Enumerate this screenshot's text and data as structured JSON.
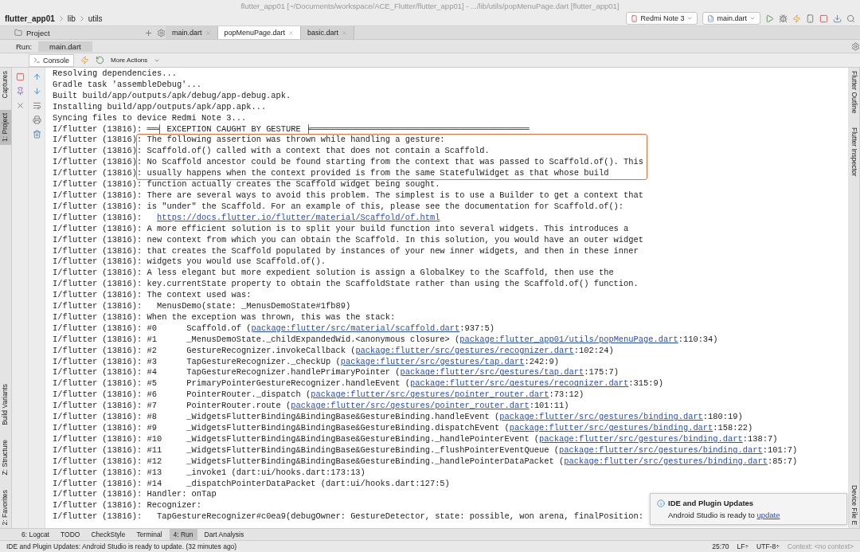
{
  "window": {
    "title": "flutter_app01 [~/Documents/workspace/ACE_Flutter/flutter_app01] - .../lib/utils/popMenuPage.dart [flutter_app01]"
  },
  "breadcrumb": [
    "flutter_app01",
    "lib",
    "utils"
  ],
  "toolbar": {
    "device": "Redmi Note 3",
    "run_config": "main.dart"
  },
  "project_dropdown": "Project",
  "editor_tabs": [
    {
      "label": "main.dart",
      "selected": false
    },
    {
      "label": "popMenuPage.dart",
      "selected": true
    },
    {
      "label": "basic.dart",
      "selected": false
    }
  ],
  "run": {
    "label": "Run:",
    "tab": "main.dart"
  },
  "console_toolbar": {
    "tab": "Console",
    "more_actions": "More Actions"
  },
  "left_strip": {
    "top": [
      {
        "label": "Captures",
        "selected": false
      },
      {
        "label": "1: Project",
        "selected": true
      }
    ],
    "bottom": [
      {
        "label": "Build Variants",
        "selected": false
      },
      {
        "label": "Z: Structure",
        "selected": false
      },
      {
        "label": "2: Favorites",
        "selected": false
      }
    ]
  },
  "right_strip": {
    "top": [
      "Flutter Outline",
      "Flutter Inspector"
    ],
    "bottom": [
      "Device File E"
    ]
  },
  "console": {
    "lines": [
      {
        "text": "Resolving dependencies...",
        "highlighted": false
      },
      {
        "text": "Gradle task 'assembleDebug'...",
        "highlighted": false
      },
      {
        "text": "Built build/app/outputs/apk/debug/app-debug.apk.",
        "highlighted": false
      },
      {
        "text": "Installing build/app/outputs/apk/app.apk...",
        "highlighted": false
      },
      {
        "text": "Syncing files to device Redmi Note 3...",
        "highlighted": false
      },
      {
        "tag": "I/flutter (13816)",
        "text": ": ══╡ EXCEPTION CAUGHT BY GESTURE ╞════════════════════════════════════════════",
        "highlighted": false
      },
      {
        "tag": "I/flutter (13816)",
        "text": ": The following assertion was thrown while handling a gesture:",
        "highlighted": true
      },
      {
        "tag": "I/flutter (13816)",
        "text": ": Scaffold.of() called with a context that does not contain a Scaffold.",
        "highlighted": true
      },
      {
        "tag": "I/flutter (13816)",
        "text": ": No Scaffold ancestor could be found starting from the context that was passed to Scaffold.of(). This",
        "highlighted": true
      },
      {
        "tag": "I/flutter (13816)",
        "text": ": usually happens when the context provided is from the same StatefulWidget as that whose build",
        "highlighted": true
      },
      {
        "tag": "I/flutter (13816)",
        "text": ": function actually creates the Scaffold widget being sought.",
        "highlighted": false
      },
      {
        "tag": "I/flutter (13816)",
        "text": ": There are several ways to avoid this problem. The simplest is to use a Builder to get a context that",
        "highlighted": false
      },
      {
        "tag": "I/flutter (13816)",
        "text": ": is \"under\" the Scaffold. For an example of this, please see the documentation for Scaffold.of():",
        "highlighted": false
      },
      {
        "tag": "I/flutter (13816)",
        "text": ":   ",
        "link": "https://docs.flutter.io/flutter/material/Scaffold/of.html",
        "highlighted": false
      },
      {
        "tag": "I/flutter (13816)",
        "text": ": A more efficient solution is to split your build function into several widgets. This introduces a",
        "highlighted": false
      },
      {
        "tag": "I/flutter (13816)",
        "text": ": new context from which you can obtain the Scaffold. In this solution, you would have an outer widget",
        "highlighted": false
      },
      {
        "tag": "I/flutter (13816)",
        "text": ": that creates the Scaffold populated by instances of your new inner widgets, and then in these inner",
        "highlighted": false
      },
      {
        "tag": "I/flutter (13816)",
        "text": ": widgets you would use Scaffold.of().",
        "highlighted": false
      },
      {
        "tag": "I/flutter (13816)",
        "text": ": A less elegant but more expedient solution is assign a GlobalKey to the Scaffold, then use the",
        "highlighted": false
      },
      {
        "tag": "I/flutter (13816)",
        "text": ": key.currentState property to obtain the ScaffoldState rather than using the Scaffold.of() function.",
        "highlighted": false
      },
      {
        "tag": "I/flutter (13816)",
        "text": ": The context used was:",
        "highlighted": false
      },
      {
        "tag": "I/flutter (13816)",
        "text": ":   MenusDemo(state: _MenusDemoState#1fb89)",
        "highlighted": false
      },
      {
        "tag": "I/flutter (13816)",
        "text": ": When the exception was thrown, this was the stack:",
        "highlighted": false
      },
      {
        "tag": "I/flutter (13816)",
        "text": ": #0      Scaffold.of (",
        "link": "package:flutter/src/material/scaffold.dart",
        "after": ":937:5)",
        "highlighted": false
      },
      {
        "tag": "I/flutter (13816)",
        "text": ": #1      _MenusDemoState._childExpandedWid.<anonymous closure> (",
        "link": "package:flutter_app01/utils/popMenuPage.dart",
        "after": ":110:34)",
        "highlighted": false
      },
      {
        "tag": "I/flutter (13816)",
        "text": ": #2      GestureRecognizer.invokeCallback (",
        "link": "package:flutter/src/gestures/recognizer.dart",
        "after": ":102:24)",
        "highlighted": false
      },
      {
        "tag": "I/flutter (13816)",
        "text": ": #3      TapGestureRecognizer._checkUp (",
        "link": "package:flutter/src/gestures/tap.dart",
        "after": ":242:9)",
        "highlighted": false
      },
      {
        "tag": "I/flutter (13816)",
        "text": ": #4      TapGestureRecognizer.handlePrimaryPointer (",
        "link": "package:flutter/src/gestures/tap.dart",
        "after": ":175:7)",
        "highlighted": false
      },
      {
        "tag": "I/flutter (13816)",
        "text": ": #5      PrimaryPointerGestureRecognizer.handleEvent (",
        "link": "package:flutter/src/gestures/recognizer.dart",
        "after": ":315:9)",
        "highlighted": false
      },
      {
        "tag": "I/flutter (13816)",
        "text": ": #6      PointerRouter._dispatch (",
        "link": "package:flutter/src/gestures/pointer_router.dart",
        "after": ":73:12)",
        "highlighted": false
      },
      {
        "tag": "I/flutter (13816)",
        "text": ": #7      PointerRouter.route (",
        "link": "package:flutter/src/gestures/pointer_router.dart",
        "after": ":101:11)",
        "highlighted": false
      },
      {
        "tag": "I/flutter (13816)",
        "text": ": #8      _WidgetsFlutterBinding&BindingBase&GestureBinding.handleEvent (",
        "link": "package:flutter/src/gestures/binding.dart",
        "after": ":180:19)",
        "highlighted": false
      },
      {
        "tag": "I/flutter (13816)",
        "text": ": #9      _WidgetsFlutterBinding&BindingBase&GestureBinding.dispatchEvent (",
        "link": "package:flutter/src/gestures/binding.dart",
        "after": ":158:22)",
        "highlighted": false
      },
      {
        "tag": "I/flutter (13816)",
        "text": ": #10     _WidgetsFlutterBinding&BindingBase&GestureBinding._handlePointerEvent (",
        "link": "package:flutter/src/gestures/binding.dart",
        "after": ":138:7)",
        "highlighted": false
      },
      {
        "tag": "I/flutter (13816)",
        "text": ": #11     _WidgetsFlutterBinding&BindingBase&GestureBinding._flushPointerEventQueue (",
        "link": "package:flutter/src/gestures/binding.dart",
        "after": ":101:7)",
        "highlighted": false
      },
      {
        "tag": "I/flutter (13816)",
        "text": ": #12     _WidgetsFlutterBinding&BindingBase&GestureBinding._handlePointerDataPacket (",
        "link": "package:flutter/src/gestures/binding.dart",
        "after": ":85:7)",
        "highlighted": false
      },
      {
        "tag": "I/flutter (13816)",
        "text": ": #13     _invoke1 (dart:ui/hooks.dart:173:13)",
        "highlighted": false
      },
      {
        "tag": "I/flutter (13816)",
        "text": ": #14     _dispatchPointerDataPacket (dart:ui/hooks.dart:127:5)",
        "highlighted": false
      },
      {
        "tag": "I/flutter (13816)",
        "text": ": Handler: onTap",
        "highlighted": false
      },
      {
        "tag": "I/flutter (13816)",
        "text": ": Recognizer:",
        "highlighted": false
      },
      {
        "tag": "I/flutter (13816)",
        "text": ":   TapGestureRecognizer#c0ea9(debugOwner: GestureDetector, state: possible, won arena, finalPosition:",
        "highlighted": false
      }
    ]
  },
  "notification": {
    "title": "IDE and Plugin Updates",
    "message": "Android Studio is ready to ",
    "link": "update"
  },
  "bottom_tabs": [
    {
      "label": "6: Logcat",
      "selected": false
    },
    {
      "label": "TODO",
      "selected": false
    },
    {
      "label": "CheckStyle",
      "selected": false
    },
    {
      "label": "Terminal",
      "selected": false
    },
    {
      "label": "4: Run",
      "selected": true
    },
    {
      "label": "Dart Analysis",
      "selected": false
    }
  ],
  "status_bar": {
    "message": "IDE and Plugin Updates: Android Studio is ready to update. (32 minutes ago)",
    "position": "25:70",
    "line_separator": "LF÷",
    "encoding": "UTF-8÷",
    "context": "Context: <no context>"
  }
}
